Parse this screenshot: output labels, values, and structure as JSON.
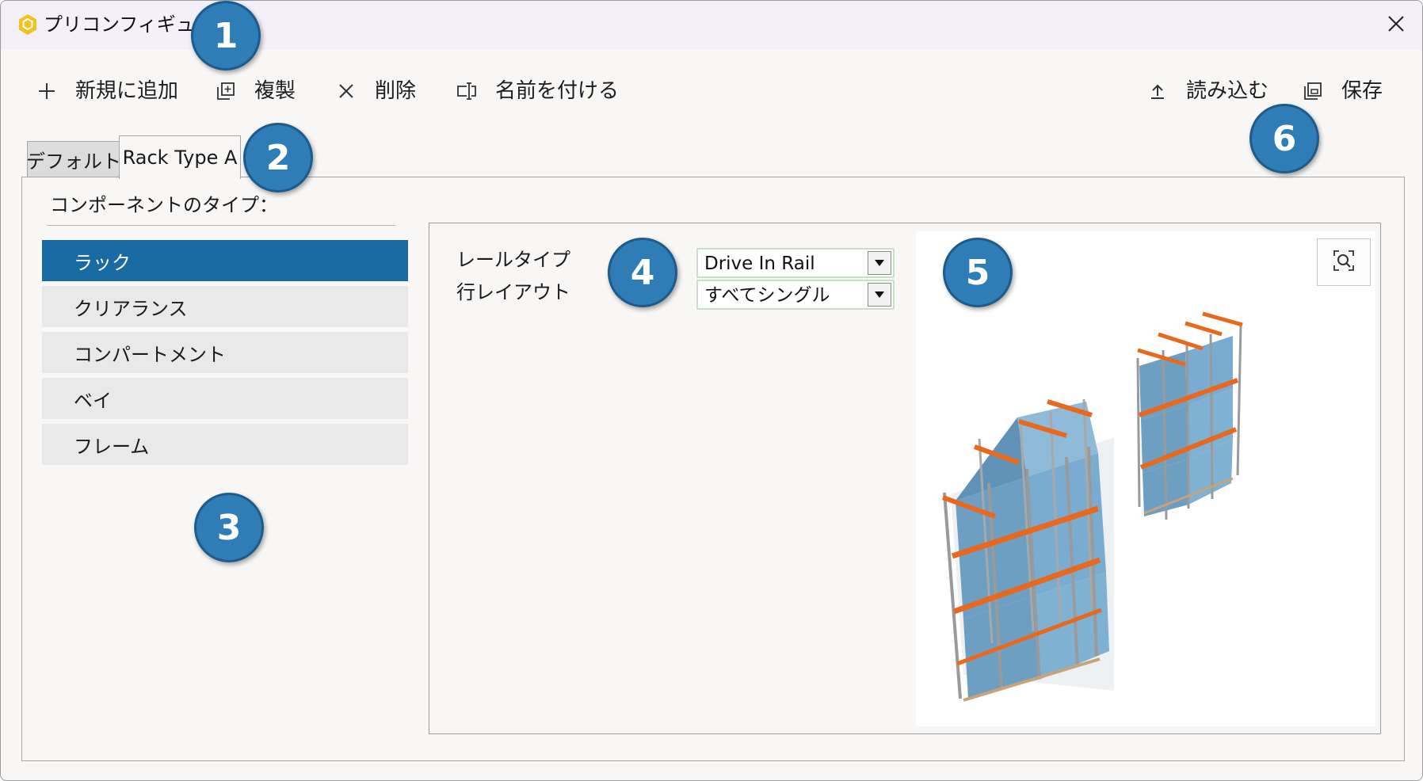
{
  "window": {
    "title": "プリコンフィギュレータ",
    "icon": "hexagon-logo-icon",
    "close_icon": "close-icon"
  },
  "toolbar": {
    "add": {
      "label": "新規に追加",
      "icon": "plus-icon"
    },
    "duplicate": {
      "label": "複製",
      "icon": "duplicate-icon"
    },
    "delete": {
      "label": "削除",
      "icon": "x-icon"
    },
    "rename": {
      "label": "名前を付ける",
      "icon": "rename-icon"
    },
    "load": {
      "label": "読み込む",
      "icon": "upload-icon"
    },
    "save": {
      "label": "保存",
      "icon": "save-icon"
    }
  },
  "tabs": [
    {
      "label": "デフォルト",
      "selected": false
    },
    {
      "label": "Rack Type A",
      "selected": true
    }
  ],
  "component_section": {
    "label": "コンポーネントのタイプ：",
    "items": [
      {
        "label": "ラック",
        "selected": true
      },
      {
        "label": "クリアランス",
        "selected": false
      },
      {
        "label": "コンパートメント",
        "selected": false
      },
      {
        "label": "ベイ",
        "selected": false
      },
      {
        "label": "フレーム",
        "selected": false
      }
    ]
  },
  "properties": [
    {
      "label": "レールタイプ",
      "value": "Drive In Rail"
    },
    {
      "label": "行レイアウト",
      "value": "すべてシングル"
    }
  ],
  "preview": {
    "zoom_icon": "zoom-fit-icon"
  },
  "callouts": [
    "1",
    "2",
    "3",
    "4",
    "5",
    "6"
  ],
  "colors": {
    "accent": "#1a6aa3",
    "callout": "#2e7db7",
    "beam": "#e8681e",
    "box": "#6fa6c9",
    "frame": "#9a9a9a"
  }
}
